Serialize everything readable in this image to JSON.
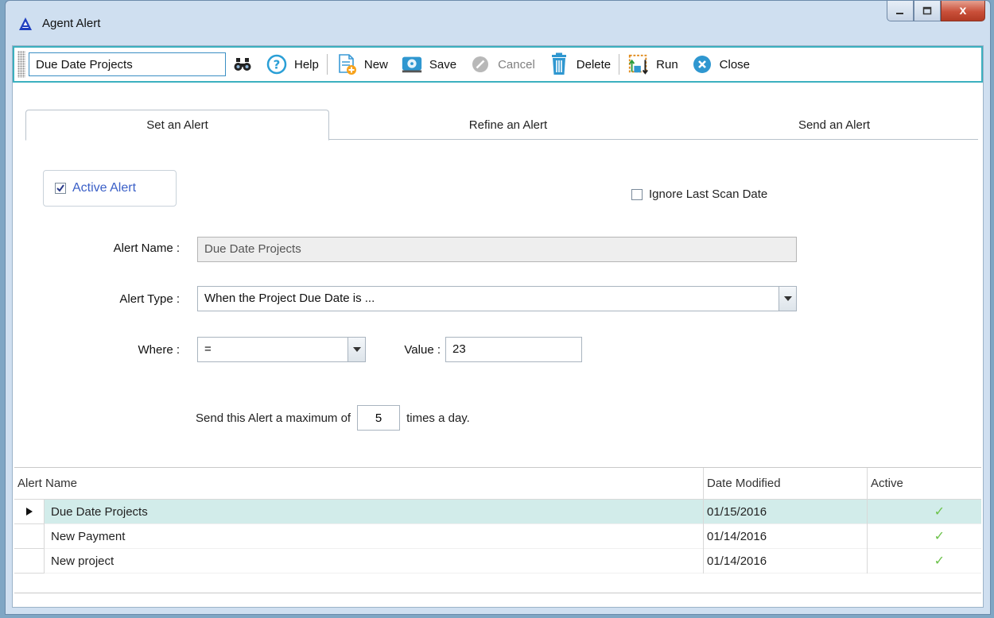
{
  "window": {
    "title": "Agent Alert",
    "caption_close": "x"
  },
  "toolbar": {
    "search_value": "Due Date Projects",
    "help_label": "Help",
    "new_label": "New",
    "save_label": "Save",
    "cancel_label": "Cancel",
    "delete_label": "Delete",
    "run_label": "Run",
    "close_label": "Close"
  },
  "tabs": [
    {
      "label": "Set an Alert",
      "active": true
    },
    {
      "label": "Refine an Alert",
      "active": false
    },
    {
      "label": "Send an Alert",
      "active": false
    }
  ],
  "form": {
    "active_alert_label": "Active Alert",
    "active_alert_checked": true,
    "ignore_last_scan_label": "Ignore Last Scan Date",
    "ignore_last_scan_checked": false,
    "alert_name_label": "Alert Name :",
    "alert_name_value": "Due Date Projects",
    "alert_type_label": "Alert Type :",
    "alert_type_value": "When the Project Due Date is ...",
    "where_label": "Where :",
    "where_value": "=",
    "value_label": "Value :",
    "value_value": "23",
    "max_prefix": "Send this Alert a maximum of",
    "max_value": "5",
    "max_suffix": "times a day."
  },
  "grid": {
    "columns": [
      "Alert Name",
      "Date Modified",
      "Active"
    ],
    "rows": [
      {
        "name": "Due Date Projects",
        "date": "01/15/2016",
        "active": "✓",
        "selected": true
      },
      {
        "name": "New Payment",
        "date": "01/14/2016",
        "active": "✓",
        "selected": false
      },
      {
        "name": "New project",
        "date": "01/14/2016",
        "active": "✓",
        "selected": false
      }
    ]
  },
  "colors": {
    "accent": "#3bb0bf",
    "selected_row": "#d2ecea",
    "check_green": "#6cc24a"
  }
}
